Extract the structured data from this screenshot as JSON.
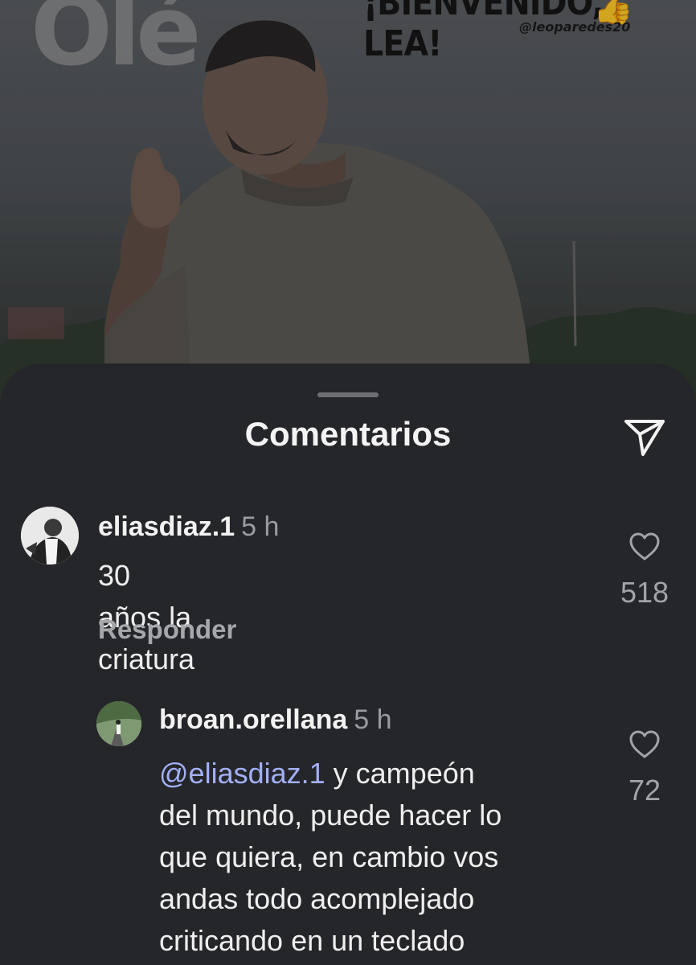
{
  "background_post": {
    "brand": "Olé",
    "headline": "¡BIENVENIDO, LEA!",
    "handle": "@leoparedes20"
  },
  "sheet": {
    "title": "Comentarios",
    "share_icon": "paper-plane-icon"
  },
  "comments": [
    {
      "username": "eliasdiaz.1",
      "time": "5 h",
      "text": "30 años la criatura",
      "reply_label": "Responder",
      "likes": "518",
      "like_icon": "heart-outline-icon"
    }
  ],
  "replies": [
    {
      "username": "broan.orellana",
      "time": "5 h",
      "mention": "@eliasdiaz.1",
      "text_lines": [
        " y campeón",
        "del mundo, puede hacer lo",
        "que quiera, en cambio vos",
        "andas todo acomplejado",
        "criticando en un teclado"
      ],
      "likes": "72",
      "like_icon": "heart-outline-icon"
    }
  ],
  "colors": {
    "sheet_bg": "#25262a",
    "mention": "#a3b0f5",
    "muted_text": "#9b9ca0"
  }
}
